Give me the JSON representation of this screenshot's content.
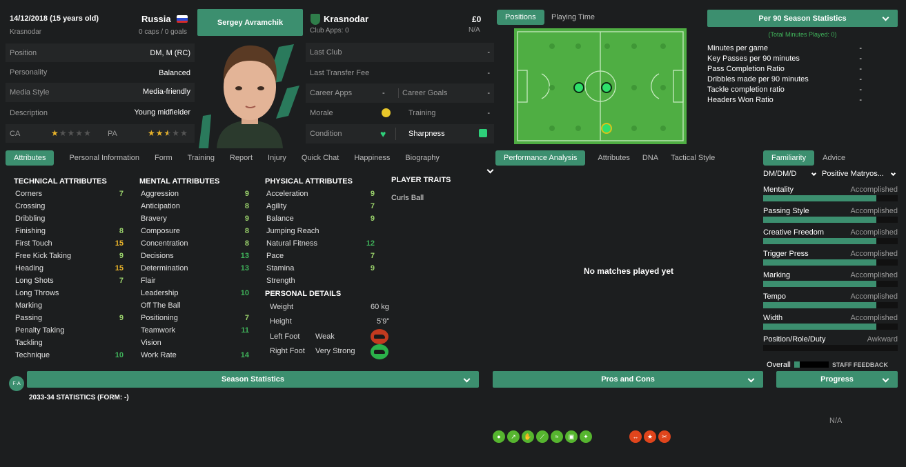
{
  "header": {
    "dob": "14/12/2018 (15 years old)",
    "hometown": "Krasnodar",
    "nation": "Russia",
    "caps": "0 caps / 0 goals",
    "player_name": "Sergey Avramchik",
    "club": "Krasnodar",
    "club_apps": "Club Apps: 0",
    "value": "£0",
    "value_sub": "N/A"
  },
  "info": {
    "position_label": "Position",
    "position": "DM, M (RC)",
    "personality_label": "Personality",
    "personality": "Balanced",
    "media_label": "Media Style",
    "media": "Media-friendly",
    "description_label": "Description",
    "description": "Young midfielder",
    "ca_label": "CA",
    "pa_label": "PA",
    "ca_stars": 1,
    "pa_stars": 2.5
  },
  "club_info": {
    "last_club_label": "Last Club",
    "last_club": "-",
    "last_fee_label": "Last Transfer Fee",
    "last_fee": "-",
    "career_apps_label": "Career Apps",
    "career_apps": "-",
    "career_goals_label": "Career Goals",
    "career_goals": "-",
    "morale_label": "Morale",
    "training_label": "Training",
    "training": "-",
    "condition_label": "Condition",
    "sharpness_label": "Sharpness"
  },
  "pitch_tabs": {
    "positions": "Positions",
    "playing_time": "Playing Time"
  },
  "stats90": {
    "dropdown": "Per 90 Season Statistics",
    "total": "(Total Minutes Played: 0)",
    "rows": [
      {
        "label": "Minutes per game",
        "value": "-"
      },
      {
        "label": "Key Passes per 90 minutes",
        "value": "-"
      },
      {
        "label": "Pass Completion Ratio",
        "value": "-"
      },
      {
        "label": "Dribbles made per 90 minutes",
        "value": "-"
      },
      {
        "label": "Tackle completion ratio",
        "value": "-"
      },
      {
        "label": "Headers Won Ratio",
        "value": "-"
      }
    ]
  },
  "tabs": [
    "Attributes",
    "Personal Information",
    "Form",
    "Training",
    "Report",
    "Injury",
    "Quick Chat",
    "Happiness",
    "Biography"
  ],
  "perf_tabs": [
    "Performance Analysis",
    "Attributes",
    "DNA",
    "Tactical Style"
  ],
  "fam_tabs": [
    "Familiarity",
    "Advice"
  ],
  "technical": {
    "title": "TECHNICAL ATTRIBUTES",
    "rows": [
      {
        "label": "Corners",
        "value": "7"
      },
      {
        "label": "Crossing",
        "value": ""
      },
      {
        "label": "Dribbling",
        "value": ""
      },
      {
        "label": "Finishing",
        "value": "8"
      },
      {
        "label": "First Touch",
        "value": "15"
      },
      {
        "label": "Free Kick Taking",
        "value": "9"
      },
      {
        "label": "Heading",
        "value": "15"
      },
      {
        "label": "Long Shots",
        "value": "7"
      },
      {
        "label": "Long Throws",
        "value": ""
      },
      {
        "label": "Marking",
        "value": ""
      },
      {
        "label": "Passing",
        "value": "9"
      },
      {
        "label": "Penalty Taking",
        "value": ""
      },
      {
        "label": "Tackling",
        "value": ""
      },
      {
        "label": "Technique",
        "value": "10"
      }
    ]
  },
  "mental": {
    "title": "MENTAL ATTRIBUTES",
    "rows": [
      {
        "label": "Aggression",
        "value": "9"
      },
      {
        "label": "Anticipation",
        "value": "8"
      },
      {
        "label": "Bravery",
        "value": "9"
      },
      {
        "label": "Composure",
        "value": "8"
      },
      {
        "label": "Concentration",
        "value": "8"
      },
      {
        "label": "Decisions",
        "value": "13"
      },
      {
        "label": "Determination",
        "value": "13"
      },
      {
        "label": "Flair",
        "value": ""
      },
      {
        "label": "Leadership",
        "value": "10"
      },
      {
        "label": "Off The Ball",
        "value": ""
      },
      {
        "label": "Positioning",
        "value": "7"
      },
      {
        "label": "Teamwork",
        "value": "11"
      },
      {
        "label": "Vision",
        "value": ""
      },
      {
        "label": "Work Rate",
        "value": "14"
      }
    ]
  },
  "physical": {
    "title": "PHYSICAL ATTRIBUTES",
    "rows": [
      {
        "label": "Acceleration",
        "value": "9"
      },
      {
        "label": "Agility",
        "value": "7"
      },
      {
        "label": "Balance",
        "value": "9"
      },
      {
        "label": "Jumping Reach",
        "value": ""
      },
      {
        "label": "Natural Fitness",
        "value": "12"
      },
      {
        "label": "Pace",
        "value": "7"
      },
      {
        "label": "Stamina",
        "value": "9"
      },
      {
        "label": "Strength",
        "value": ""
      }
    ]
  },
  "personal": {
    "title": "PERSONAL DETAILS",
    "weight_label": "Weight",
    "weight": "60 kg",
    "height_label": "Height",
    "height": "5'9\"",
    "left_label": "Left Foot",
    "left": "Weak",
    "right_label": "Right Foot",
    "right": "Very Strong"
  },
  "traits": {
    "title": "PLAYER TRAITS",
    "items": [
      "Curls Ball"
    ]
  },
  "performance": {
    "empty": "No matches played yet"
  },
  "familiarity": {
    "role_select": "DM/DM/D",
    "style_select": "Positive Matryos...",
    "rows": [
      {
        "label": "Mentality",
        "level": "Accomplished",
        "fill": 0.84
      },
      {
        "label": "Passing Style",
        "level": "Accomplished",
        "fill": 0.84
      },
      {
        "label": "Creative Freedom",
        "level": "Accomplished",
        "fill": 0.84
      },
      {
        "label": "Trigger Press",
        "level": "Accomplished",
        "fill": 0.84
      },
      {
        "label": "Marking",
        "level": "Accomplished",
        "fill": 0.84
      },
      {
        "label": "Tempo",
        "level": "Accomplished",
        "fill": 0.84
      },
      {
        "label": "Width",
        "level": "Accomplished",
        "fill": 0.84
      },
      {
        "label": "Position/Role/Duty",
        "level": "Awkward",
        "fill": 0.0
      }
    ],
    "overall_label": "Overall",
    "feedback": "STAFF FEEDBACK"
  },
  "bottom": {
    "season_stats": "Season Statistics",
    "season_heading": "2033-34 STATISTICS (FORM: -)",
    "pros_cons": "Pros and Cons",
    "progress": "Progress",
    "progress_value": "N/A",
    "fa_badge": "F·A"
  },
  "colors": {
    "accent": "#3c8f6f",
    "good": "#3fb25a",
    "warn": "#e8b32a",
    "bad": "#c33a1f",
    "pros": "#56b52f",
    "cons": "#e0451c"
  },
  "icons": {
    "pros": [
      "shot-icon",
      "trend-icon",
      "glove-icon",
      "boot-icon",
      "pass-icon",
      "card-icon",
      "tackle-icon"
    ],
    "cons": [
      "strength-icon",
      "star-icon",
      "kick-icon"
    ]
  }
}
